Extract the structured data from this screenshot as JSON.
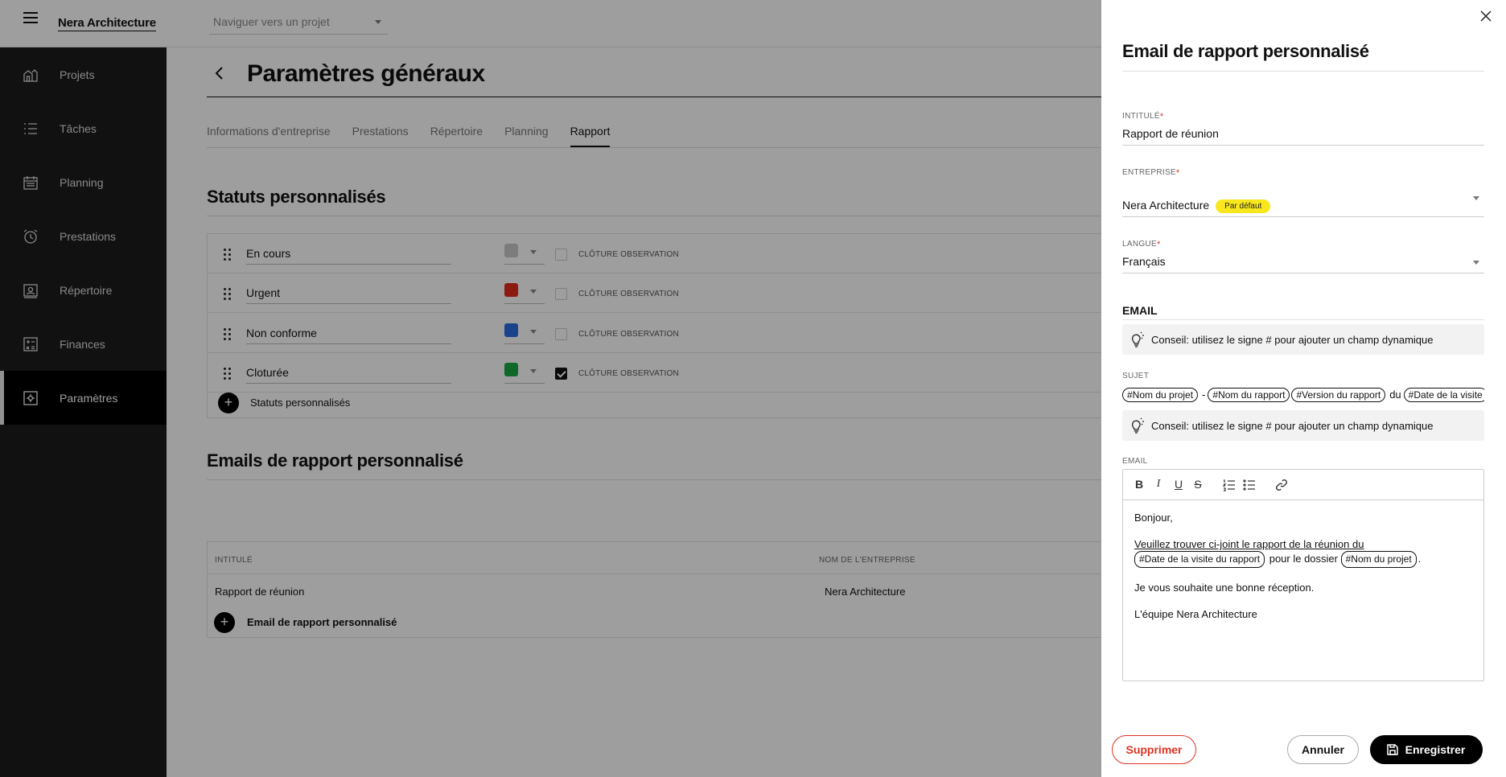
{
  "topbar": {
    "brand": "Nera Architecture",
    "project_placeholder": "Naviguer vers un projet"
  },
  "sidebar": {
    "items": [
      {
        "label": "Projets",
        "icon": "home-icon"
      },
      {
        "label": "Tâches",
        "icon": "list-icon"
      },
      {
        "label": "Planning",
        "icon": "calendar-icon"
      },
      {
        "label": "Prestations",
        "icon": "alarm-clock-icon"
      },
      {
        "label": "Répertoire",
        "icon": "contact-card-icon"
      },
      {
        "label": "Finances",
        "icon": "calculator-icon"
      },
      {
        "label": "Paramètres",
        "icon": "settings-icon",
        "active": true
      }
    ]
  },
  "main": {
    "title": "Paramètres généraux",
    "tabs": [
      "Informations d'entreprise",
      "Prestations",
      "Répertoire",
      "Planning",
      "Rapport"
    ],
    "active_tab": "Rapport",
    "statuses": {
      "title": "Statuts personnalisés",
      "rows": [
        {
          "name": "En cours",
          "color": "#c8c8c8",
          "closing": false
        },
        {
          "name": "Urgent",
          "color": "#e02a1b",
          "closing": false
        },
        {
          "name": "Non conforme",
          "color": "#2a6de0",
          "closing": false
        },
        {
          "name": "Cloturée",
          "color": "#15a845",
          "closing": true
        }
      ],
      "closing_label": "CLÔTURE OBSERVATION",
      "add_label": "Statuts personnalisés"
    },
    "emails": {
      "title": "Emails de rapport personnalisé",
      "columns": [
        "INTITULÉ",
        "NOM DE L'ENTREPRISE"
      ],
      "rows": [
        {
          "name": "Rapport de réunion",
          "company": "Nera Architecture"
        }
      ],
      "add_label": "Email de rapport personnalisé"
    }
  },
  "drawer": {
    "title": "Email de rapport personnalisé",
    "fields": {
      "intitule_label": "INTITULÉ",
      "intitule_value": "Rapport de réunion",
      "entreprise_label": "ENTREPRISE",
      "entreprise_value": "Nera Architecture",
      "entreprise_badge": "Par défaut",
      "langue_label": "LANGUE",
      "langue_value": "Français"
    },
    "email_heading": "EMAIL",
    "tip": "Conseil: utilisez le signe # pour ajouter un champ dynamique",
    "subject_label": "SUJET",
    "subject_tokens": [
      "#Nom du projet",
      "-",
      "#Nom du rapport",
      "#Version du rapport",
      "du",
      "#Date de la visite"
    ],
    "email_label": "EMAIL",
    "body": {
      "greeting": "Bonjour,",
      "line1_a": "Veuillez trouver ci-joint le rapport de la réunion du",
      "chip_date": "#Date de la visite du rapport",
      "line1_b": "pour le dossier",
      "chip_project": "#Nom du projet",
      "line1_end": ".",
      "line2": "Je vous souhaite une bonne réception.",
      "signature": "L'équipe Nera Architecture"
    },
    "buttons": {
      "delete": "Supprimer",
      "cancel": "Annuler",
      "save": "Enregistrer"
    }
  }
}
